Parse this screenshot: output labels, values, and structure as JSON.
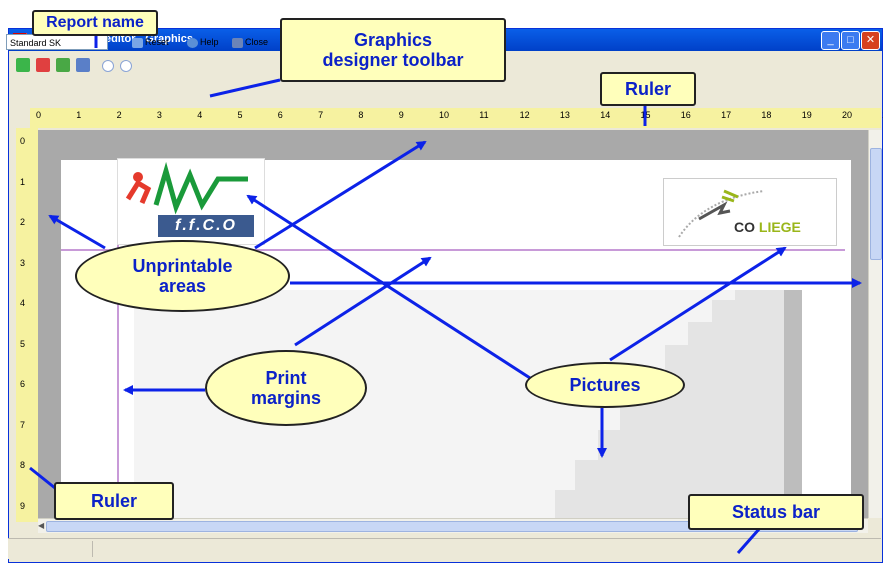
{
  "window": {
    "title": "Report layout editor - Graphics",
    "minimize_icon": "minimize-icon",
    "maximize_icon": "maximize-icon",
    "close_icon": "close-icon"
  },
  "toolbar": {
    "report_name_value": "Standard SK",
    "reset_label": "Reset",
    "help_label": "Help",
    "close_label": "Close"
  },
  "rulers": {
    "horizontal_ticks": [
      "0",
      "1",
      "2",
      "3",
      "4",
      "5",
      "6",
      "7",
      "8",
      "9",
      "10",
      "11",
      "12",
      "13",
      "14",
      "15",
      "16",
      "17",
      "18",
      "19",
      "20",
      "2"
    ],
    "vertical_ticks": [
      "0",
      "1",
      "2",
      "3",
      "4",
      "5",
      "6",
      "7",
      "8",
      "9"
    ]
  },
  "logos": {
    "ffco_text": "f.f.C.O",
    "co_prefix": "CO",
    "co_suffix": "LIEGE"
  },
  "callouts": {
    "report_name": "Report name",
    "graphics_toolbar_line1": "Graphics",
    "graphics_toolbar_line2": "designer toolbar",
    "ruler_top": "Ruler",
    "unprintable_line1": "Unprintable",
    "unprintable_line2": "areas",
    "print_margins_line1": "Print",
    "print_margins_line2": "margins",
    "pictures": "Pictures",
    "ruler_left": "Ruler",
    "status_bar": "Status bar"
  },
  "colors": {
    "titlebar": "#0a5fe8",
    "callout_fill": "#ffffbb",
    "callout_text": "#0c22c8",
    "arrow": "#0c22e8",
    "ruler": "#f6f2a0",
    "margin_line": "#c89ad8"
  }
}
